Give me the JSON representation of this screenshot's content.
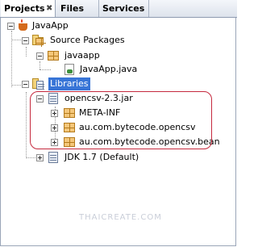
{
  "tabs": [
    {
      "label": "Projects",
      "close": "✖"
    },
    {
      "label": "Files"
    },
    {
      "label": "Services"
    }
  ],
  "tree": {
    "project": "JavaApp",
    "source_packages": "Source Packages",
    "package": "javaapp",
    "file": "JavaApp.java",
    "libraries": "Libraries",
    "jar": "opencsv-2.3.jar",
    "jar_children": [
      "META-INF",
      "au.com.bytecode.opencsv",
      "au.com.bytecode.opencsv.bean"
    ],
    "jdk": "JDK 1.7 (Default)"
  },
  "watermark": "THAICREATE.COM",
  "colors": {
    "selection": "#3875d7",
    "highlight_box": "#c52a3e"
  }
}
